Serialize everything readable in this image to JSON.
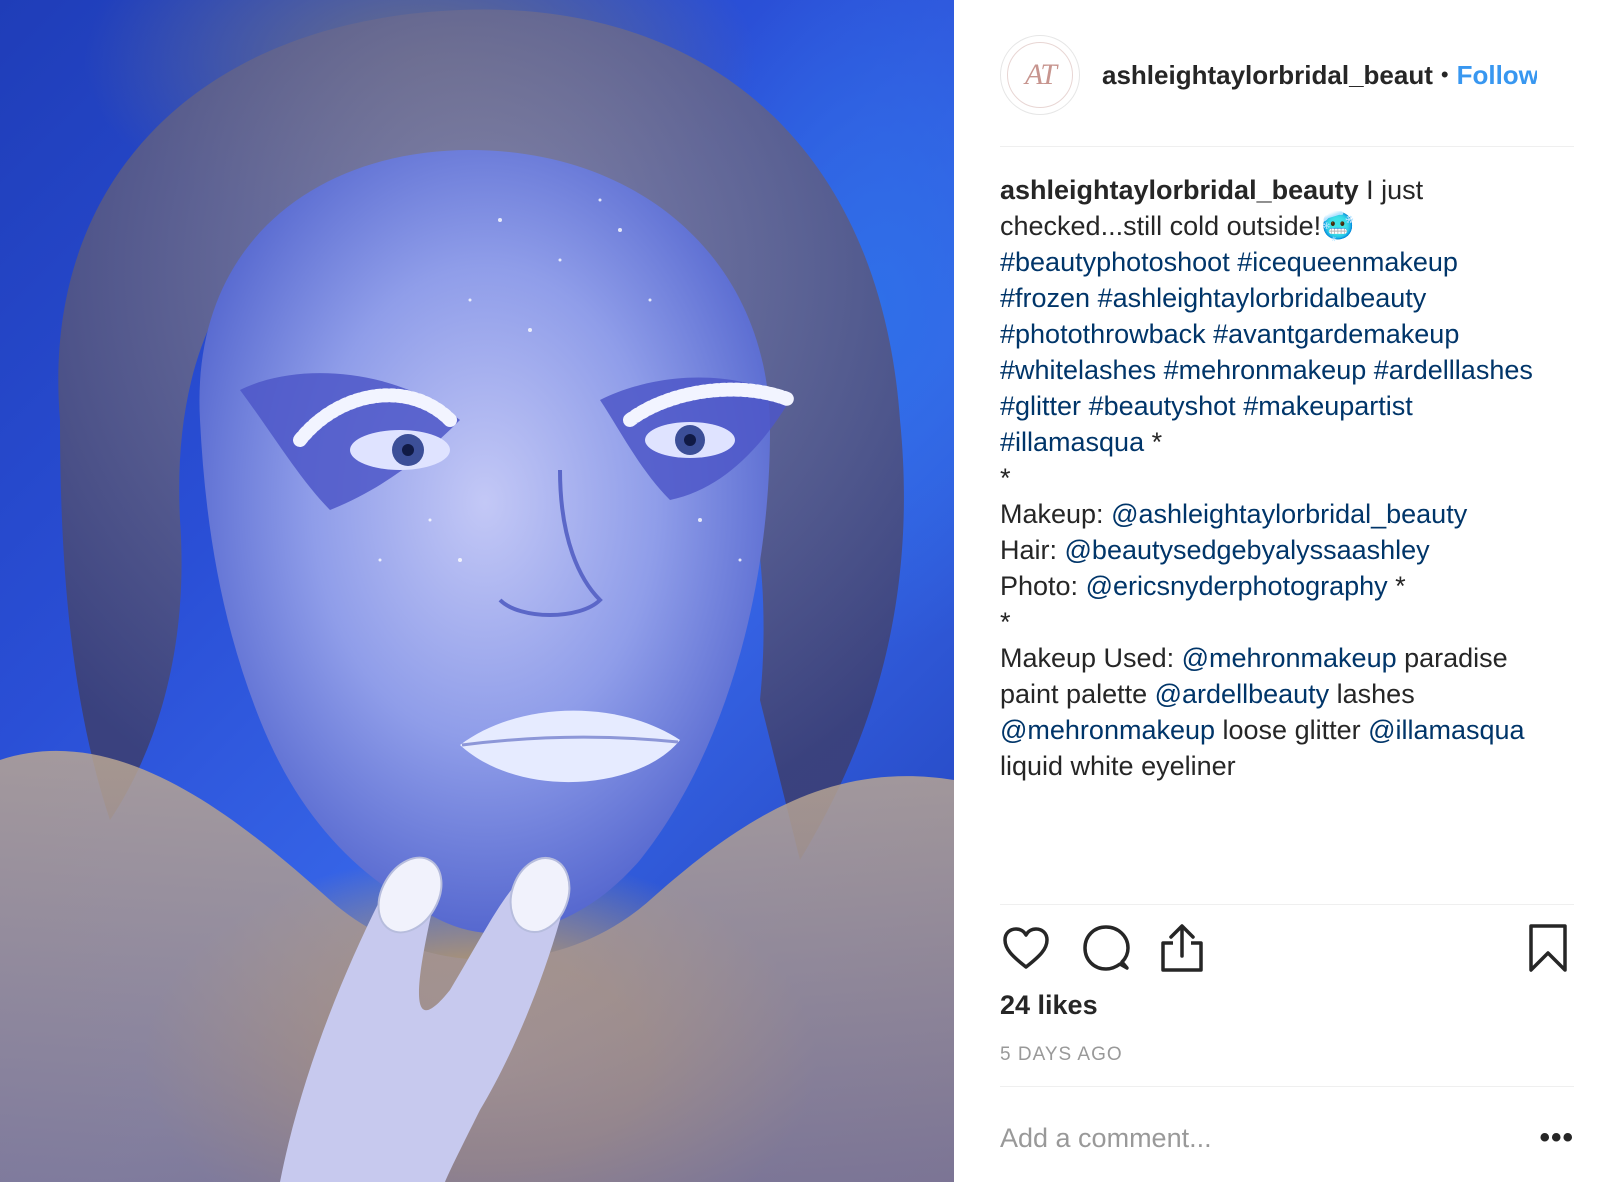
{
  "post": {
    "image": {
      "alt": ""
    },
    "header": {
      "avatar_monogram": "AT",
      "username": "ashleightaylorbridal_beaut",
      "separator": "•",
      "follow_label": "Follow"
    },
    "caption": {
      "author": "ashleightaylorbridal_beauty",
      "line1_text": " I just",
      "line2_text": "checked...still cold outside!",
      "line2_emoji": "🥶",
      "line3": [
        "#beautyphotoshoot",
        " ",
        "#icequeenmakeup"
      ],
      "line4": [
        "#frozen",
        " ",
        "#ashleightaylorbridalbeauty"
      ],
      "line5": [
        "#photothrowback",
        " ",
        "#avantgardemakeup"
      ],
      "line6": [
        "#whitelashes",
        " ",
        "#mehronmakeup",
        " ",
        "#ardelllashes"
      ],
      "line7": [
        "#glitter",
        " ",
        "#beautyshot",
        " ",
        "#makeupartist"
      ],
      "line8_tag": "#illamasqua",
      "line8_text": " *",
      "line9": "*",
      "line10_label": "Makeup: ",
      "line10_mention": "@ashleightaylorbridal_beauty",
      "line11_label": "Hair: ",
      "line11_mention": "@beautysedgebyalyssaashley",
      "line12_label": "Photo: ",
      "line12_mention": "@ericsnyderphotography",
      "line12_text": " *",
      "line13": "*",
      "line14_label": "Makeup Used: ",
      "line14_mention": "@mehronmakeup",
      "line14_text": " paradise",
      "line15_text": "paint palette ",
      "line15_mention": "@ardellbeauty",
      "line15_text2": " lashes",
      "line16_mention": "@mehronmakeup",
      "line16_text": " loose glitter ",
      "line16_mention2": "@illamasqua",
      "line17": "liquid white eyeliner"
    },
    "actions": {
      "like_icon": "heart-icon",
      "comment_icon": "comment-bubble-icon",
      "share_icon": "share-upload-icon",
      "save_icon": "bookmark-icon"
    },
    "likes": "24 likes",
    "time": "5 DAYS AGO",
    "comment": {
      "placeholder": "Add a comment...",
      "more_label": "•••"
    }
  },
  "colors": {
    "link": "#003569",
    "follow": "#3897f0",
    "text": "#262626",
    "muted": "#999999",
    "divider": "#efefef"
  }
}
